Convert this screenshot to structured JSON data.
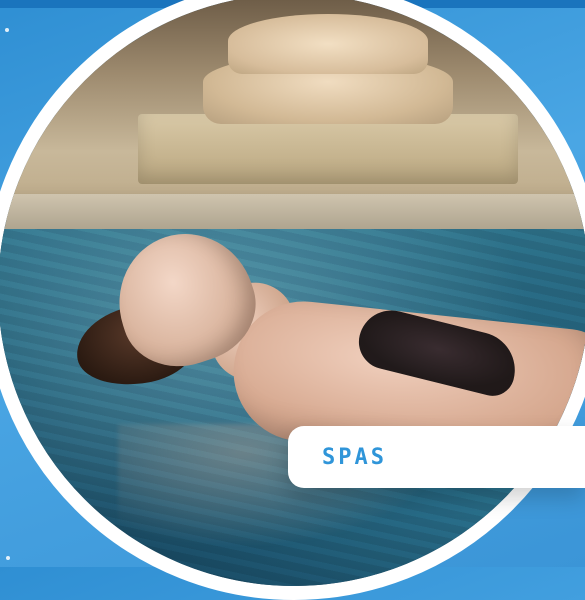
{
  "card": {
    "label": "SPAS"
  },
  "decor": {
    "accent_color": "#2f95d9",
    "background_color": "#3b95d7",
    "ring_color": "#ffffff",
    "dots": [
      "top-left-dot",
      "bottom-left-dot"
    ]
  },
  "image": {
    "subject": "spa photo"
  }
}
